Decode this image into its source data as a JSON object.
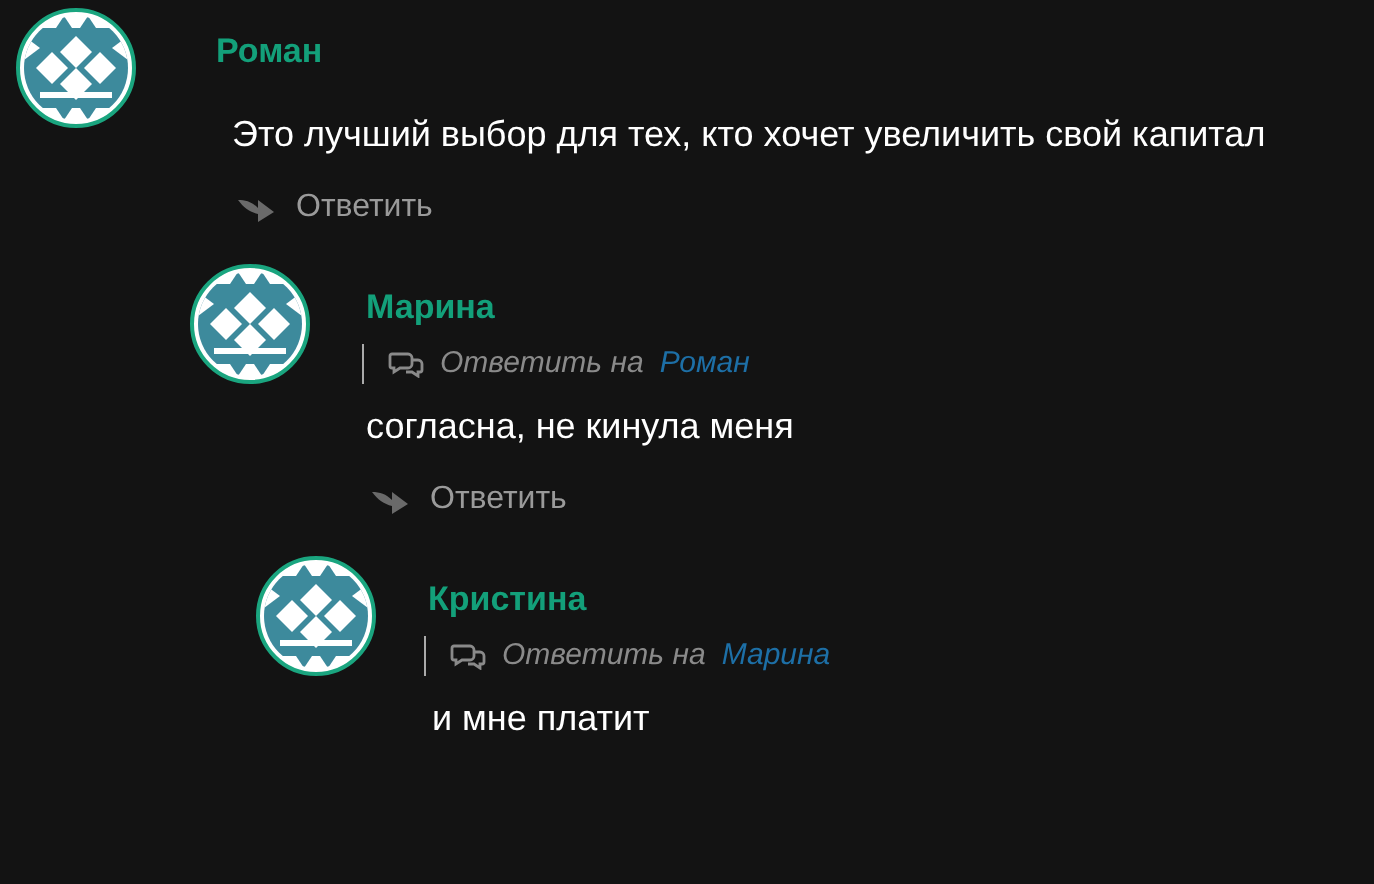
{
  "comments": [
    {
      "author": "Роман",
      "text": "Это лучший выбор для тех, кто хочет увеличить свой капитал",
      "reply_button": "Ответить",
      "children": [
        {
          "author": "Марина",
          "reply_to": {
            "label": "Ответить на",
            "target": "Роман"
          },
          "text": "согласна, не кинула меня",
          "reply_button": "Ответить",
          "children": [
            {
              "author": "Кристина",
              "reply_to": {
                "label": "Ответить на",
                "target": "Марина"
              },
              "text": "и мне платит"
            }
          ]
        }
      ]
    }
  ]
}
